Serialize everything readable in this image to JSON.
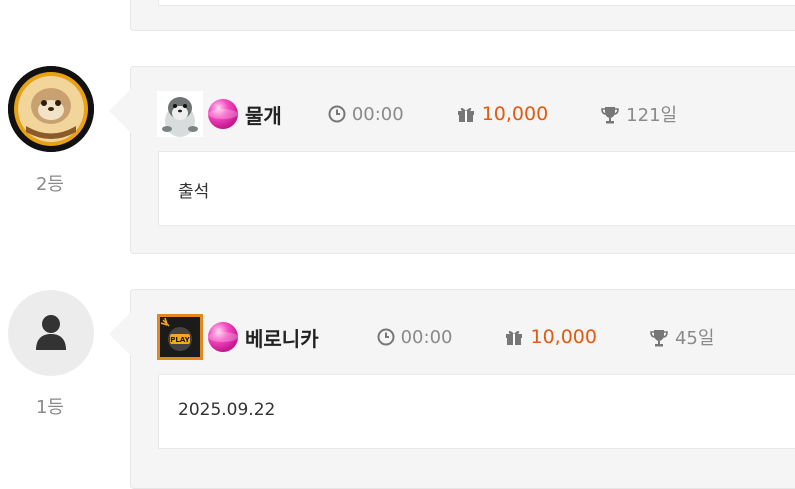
{
  "entries": [
    {
      "rank": "2등",
      "nickname": "물개",
      "time": "00:00",
      "points": "10,000",
      "days": "121일",
      "message": "출석"
    },
    {
      "rank": "1등",
      "nickname": "베로니카",
      "time": "00:00",
      "points": "10,000",
      "days": "45일",
      "message": "2025.09.22"
    }
  ],
  "icons": {
    "time": "clock-icon",
    "points": "gift-icon",
    "days": "trophy-icon",
    "level": "level-ball-icon",
    "default_avatar": "user-silhouette-icon"
  },
  "colors": {
    "points": "#e4590f",
    "muted": "#8a8a8a",
    "card_bg": "#f5f5f5"
  }
}
